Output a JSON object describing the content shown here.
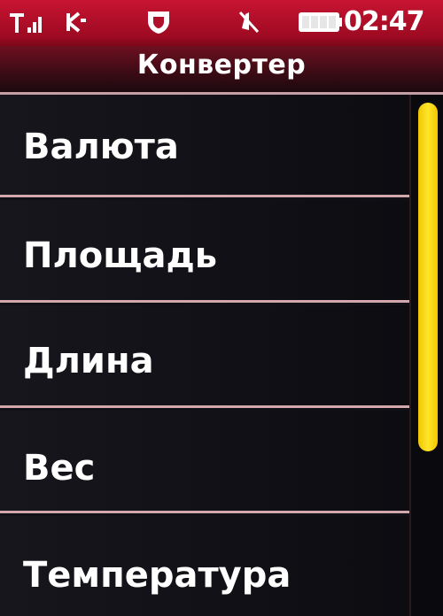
{
  "status_bar": {
    "clock": "02:47",
    "icons": [
      "signal-icon",
      "network-icon",
      "shield-icon",
      "mute-icon",
      "battery-icon"
    ],
    "background_color": "#b0102a"
  },
  "header": {
    "title": "Конвертер"
  },
  "menu": {
    "items": [
      {
        "label": "Валюта"
      },
      {
        "label": "Площадь"
      },
      {
        "label": "Длина"
      },
      {
        "label": "Вес"
      },
      {
        "label": "Температура"
      }
    ]
  },
  "scrollbar": {
    "thumb_color": "#ffd200"
  },
  "colors": {
    "accent": "#c81432",
    "divider": "#d2a8ac",
    "list_background": "#121218"
  }
}
